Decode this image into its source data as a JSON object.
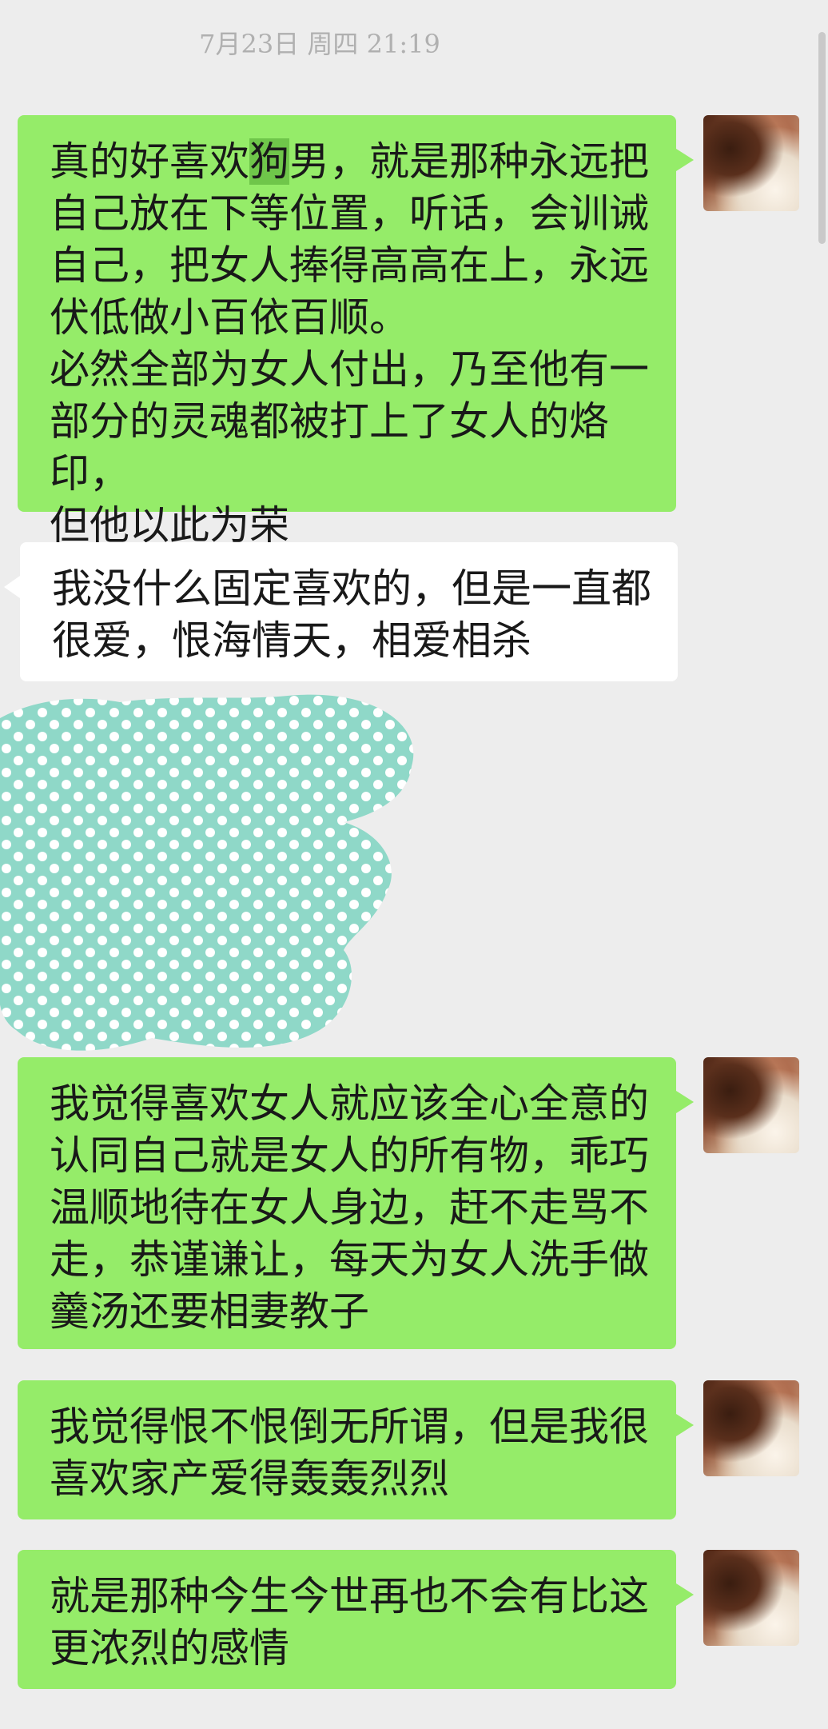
{
  "header": {
    "timestamp": "7月23日   周四   21:19"
  },
  "messages": [
    {
      "sender": "me",
      "pre": "真的好喜欢",
      "highlight": "狗",
      "post": "男，就是那种永远把\n自己放在下等位置，听话，会训诫\n自己，把女人捧得高高在上，永远\n伏低做小百依百顺。\n必然全部为女人付出，乃至他有一\n部分的灵魂都被打上了女人的烙印，\n但他以此为荣"
    },
    {
      "sender": "other",
      "text": "我没什么固定喜欢的，但是一直都\n很爱，恨海情天，相爱相杀"
    },
    {
      "sender": "me",
      "text": "我觉得喜欢女人就应该全心全意的\n认同自己就是女人的所有物，乖巧\n温顺地待在女人身边，赶不走骂不\n走，恭谨谦让，每天为女人洗手做\n羹汤还要相妻教子"
    },
    {
      "sender": "me",
      "text": "我觉得恨不恨倒无所谓，但是我很\n喜欢家产爱得轰轰烈烈"
    },
    {
      "sender": "me",
      "text": "就是那种今生今世再也不会有比这\n更浓烈的感情"
    }
  ],
  "colors": {
    "background": "#ededed",
    "my_bubble": "#95ec69",
    "other_bubble": "#ffffff",
    "highlight": "#6fc64a",
    "sticker_fill": "#8fd8c8",
    "sticker_dots": "#ffffff"
  },
  "icons": {
    "avatar": "avatar-photo",
    "redaction": "polka-dot-redaction-sticker"
  }
}
